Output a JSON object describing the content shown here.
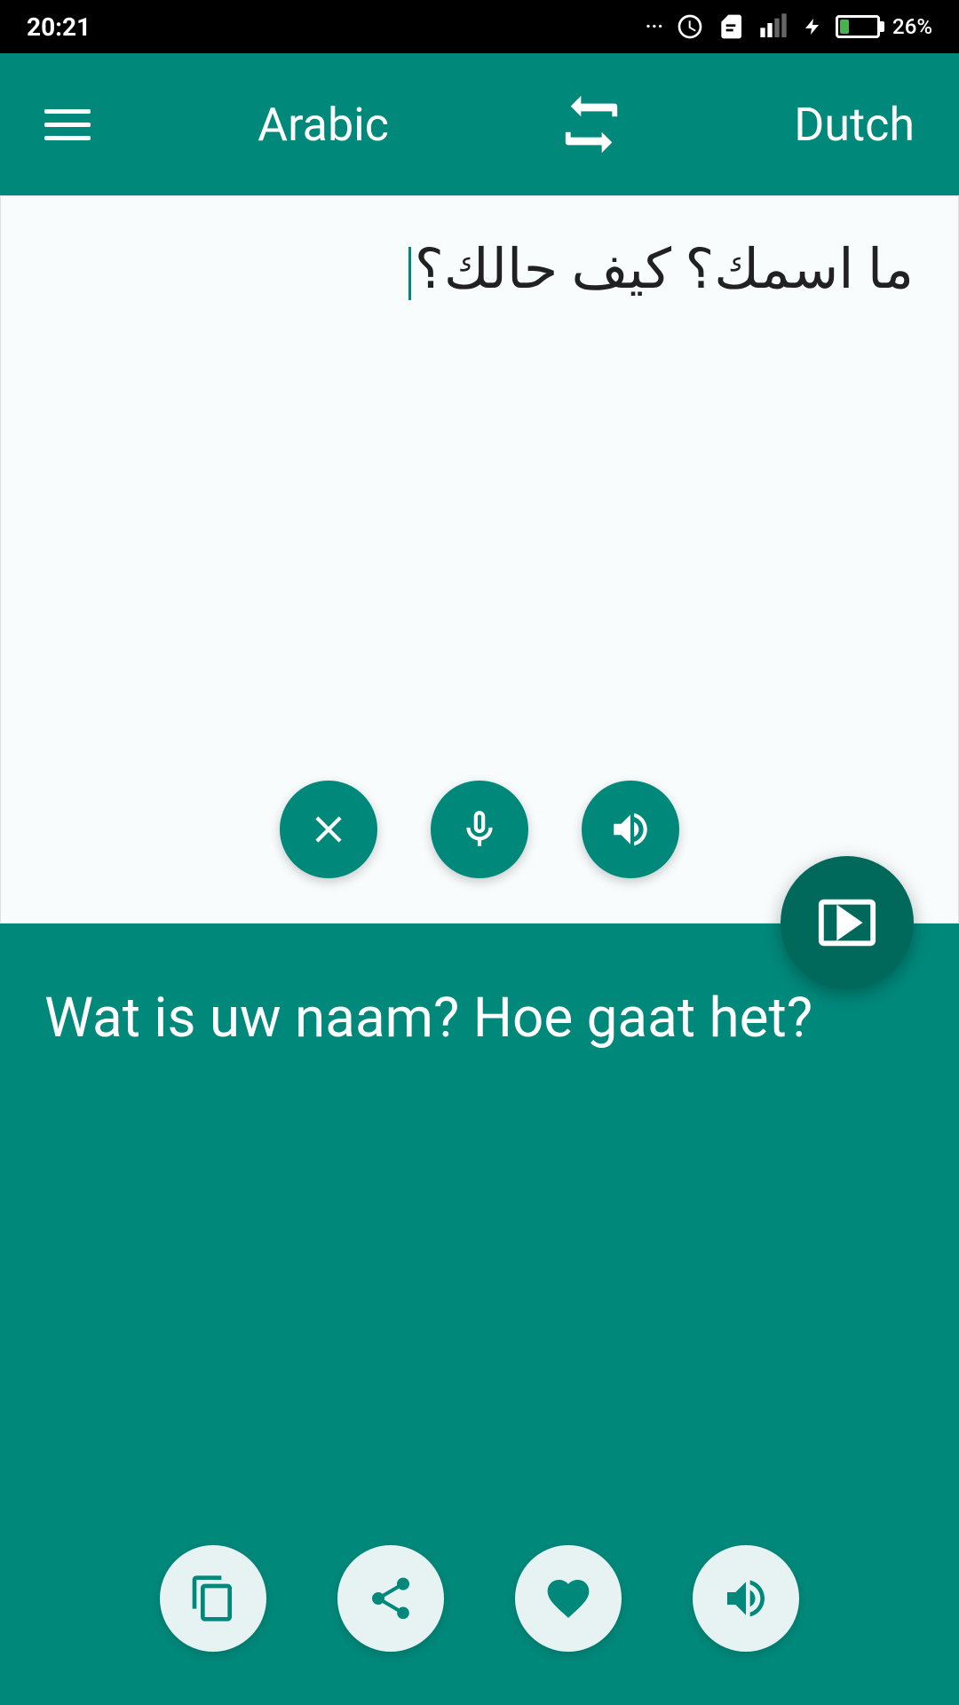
{
  "statusBar": {
    "time": "20:21",
    "battery": "26%"
  },
  "header": {
    "menuIcon": "menu-icon",
    "sourceLang": "Arabic",
    "swapIcon": "swap-icon",
    "targetLang": "Dutch"
  },
  "inputPanel": {
    "text": "ما اسمك؟ كيف حالك؟",
    "clearButton": "clear-button",
    "micButton": "mic-button",
    "speakerButton": "speaker-button"
  },
  "sendButton": "send-button",
  "translationPanel": {
    "text": "Wat is uw naam? Hoe gaat het?",
    "copyButton": "copy-button",
    "shareButton": "share-button",
    "favoriteButton": "favorite-button",
    "speakerButton": "translation-speaker-button"
  },
  "colors": {
    "teal": "#00897b",
    "darkTeal": "#00695c",
    "white": "#ffffff"
  }
}
